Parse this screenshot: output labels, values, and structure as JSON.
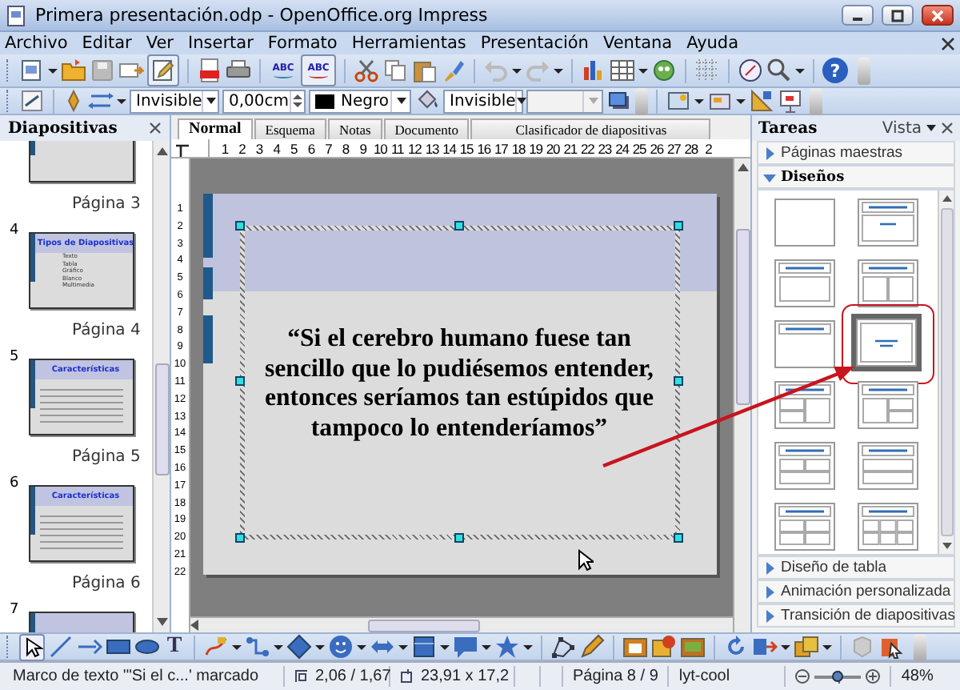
{
  "window": {
    "title": "Primera presentación.odp - OpenOffice.org Impress"
  },
  "menu": [
    "Archivo",
    "Editar",
    "Ver",
    "Insertar",
    "Formato",
    "Herramientas",
    "Presentación",
    "Ventana",
    "Ayuda"
  ],
  "standard_toolbar": {
    "spellcheck_label": "ABC",
    "autospell_label": "ABC",
    "help_label": "?"
  },
  "line_toolbar": {
    "line_style": "Invisible",
    "line_width": "0,00cm",
    "line_color": "Negro",
    "area_style": "Invisible"
  },
  "slides_panel": {
    "title": "Diapositivas",
    "slides": [
      {
        "label": "Página 3"
      },
      {
        "number": "4",
        "label": "Página 4",
        "title": "Tipos de Diapositivas",
        "bullets": [
          "Texto",
          "Tabla",
          "Gráfico",
          "Blanco",
          "Multimedia"
        ]
      },
      {
        "number": "5",
        "label": "Página 5",
        "title": "Características"
      },
      {
        "number": "6",
        "label": "Página 6",
        "title": "Características"
      },
      {
        "number": "7"
      }
    ]
  },
  "view_tabs": [
    {
      "label": "Normal",
      "selected": true
    },
    {
      "label": "Esquema",
      "selected": false
    },
    {
      "label": "Notas",
      "selected": false
    },
    {
      "label": "Documento",
      "selected": false
    },
    {
      "label": "Clasificador de diapositivas",
      "selected": false
    }
  ],
  "ruler": {
    "horizontal": [
      "1",
      "2",
      "3",
      "4",
      "5",
      "6",
      "7",
      "8",
      "9",
      "10",
      "11",
      "12",
      "13",
      "14",
      "15",
      "16",
      "17",
      "18",
      "19",
      "20",
      "21",
      "22",
      "23",
      "24",
      "25",
      "26",
      "27",
      "28",
      "2"
    ],
    "vertical": [
      "1",
      "2",
      "3",
      "4",
      "5",
      "6",
      "7",
      "8",
      "9",
      "10",
      "11",
      "12",
      "13",
      "14",
      "15",
      "16",
      "17",
      "18",
      "19",
      "20",
      "21",
      "22"
    ]
  },
  "slide": {
    "quote": "“Si el cerebro humano fuese tan sencillo que lo pudiésemos entender, entonces seríamos tan estúpidos que tampoco lo entenderíamos”"
  },
  "tasks_panel": {
    "title": "Tareas",
    "view_label": "Vista",
    "sections_before": [
      {
        "label": "Páginas maestras",
        "expanded": false
      },
      {
        "label": "Diseños",
        "expanded": true
      }
    ],
    "layouts": [
      {
        "kind": "blank",
        "selected": false
      },
      {
        "kind": "title-subtitle",
        "selected": false
      },
      {
        "kind": "title-content",
        "selected": false
      },
      {
        "kind": "title-2content",
        "selected": false
      },
      {
        "kind": "title-only",
        "selected": false
      },
      {
        "kind": "centered-text",
        "selected": true
      },
      {
        "kind": "title-2content-content",
        "selected": false
      },
      {
        "kind": "title-content-2content",
        "selected": false
      },
      {
        "kind": "title-2content-over-content",
        "selected": false
      },
      {
        "kind": "title-content-over-content",
        "selected": false
      },
      {
        "kind": "title-4content",
        "selected": false
      },
      {
        "kind": "title-6content",
        "selected": false
      }
    ],
    "sections_after": [
      {
        "label": "Diseño de tabla",
        "expanded": false
      },
      {
        "label": "Animación personalizada",
        "expanded": false
      },
      {
        "label": "Transición de diapositivas",
        "expanded": false
      }
    ]
  },
  "drawing_toolbar": {
    "text_tool_label": "T"
  },
  "status_bar": {
    "selection": "Marco de texto '\"Si el c...' marcado",
    "position": "2,06 / 1,67",
    "size": "23,91 x 17,2",
    "page": "Página 8 / 9",
    "master": "lyt-cool",
    "zoom": {
      "level": 0.48,
      "reading": "48%"
    }
  }
}
